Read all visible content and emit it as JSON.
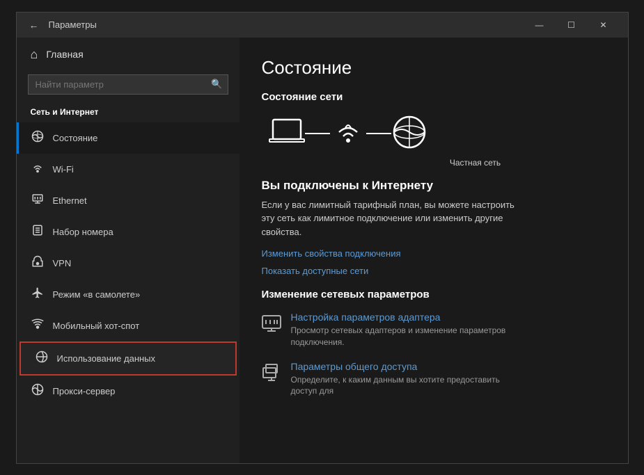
{
  "window": {
    "title": "Параметры",
    "controls": {
      "minimize": "—",
      "maximize": "☐",
      "close": "✕"
    }
  },
  "sidebar": {
    "back_label": "←",
    "home_label": "Главная",
    "search_placeholder": "Найти параметр",
    "section_title": "Сеть и Интернет",
    "items": [
      {
        "id": "status",
        "icon": "🌐",
        "label": "Состояние",
        "active": true
      },
      {
        "id": "wifi",
        "icon": "📶",
        "label": "Wi-Fi"
      },
      {
        "id": "ethernet",
        "icon": "🖥",
        "label": "Ethernet"
      },
      {
        "id": "dialup",
        "icon": "📞",
        "label": "Набор номера"
      },
      {
        "id": "vpn",
        "icon": "🔒",
        "label": "VPN"
      },
      {
        "id": "airplane",
        "icon": "✈",
        "label": "Режим «в самолете»"
      },
      {
        "id": "hotspot",
        "icon": "📡",
        "label": "Мобильный хот-спот"
      },
      {
        "id": "datausage",
        "icon": "🌐",
        "label": "Использование данных",
        "highlighted": true
      },
      {
        "id": "proxy",
        "icon": "🌐",
        "label": "Прокси-сервер"
      }
    ]
  },
  "main": {
    "title": "Состояние",
    "network_status_title": "Состояние сети",
    "network_label": "Частная сеть",
    "connected_title": "Вы подключены к Интернету",
    "connected_desc": "Если у вас лимитный тарифный план, вы можете настроить эту сеть как лимитное подключение или изменить другие свойства.",
    "link1": "Изменить свойства подключения",
    "link2": "Показать доступные сети",
    "change_settings_title": "Изменение сетевых параметров",
    "settings_items": [
      {
        "id": "adapter",
        "icon": "🖧",
        "title": "Настройка параметров адаптера",
        "desc": "Просмотр сетевых адаптеров и изменение параметров подключения."
      },
      {
        "id": "sharing",
        "icon": "🖨",
        "title": "Параметры общего доступа",
        "desc": "Определите, к каким данным вы хотите предоставить доступ для"
      }
    ]
  }
}
